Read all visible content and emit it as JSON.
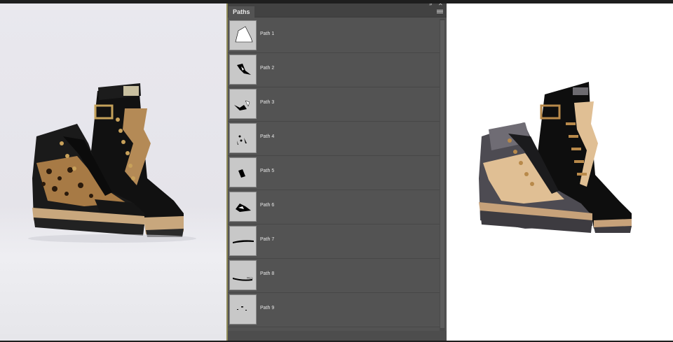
{
  "panel": {
    "tab_label": "Paths",
    "collapse_icon": "double-chevron-icon",
    "close_icon": "close-icon",
    "menu_icon": "panel-menu-icon"
  },
  "paths": [
    {
      "label": "Path 1"
    },
    {
      "label": "Path 2"
    },
    {
      "label": "Path 3"
    },
    {
      "label": "Path 4"
    },
    {
      "label": "Path 5"
    },
    {
      "label": "Path 6"
    },
    {
      "label": "Path 7"
    },
    {
      "label": "Path 8"
    },
    {
      "label": "Path 9"
    }
  ],
  "colors": {
    "photo_bg": "#e9e8ee",
    "panel_bg": "#535353",
    "vector_bg": "#ffffff",
    "boot_black": "#0d0d0d",
    "boot_grey": "#4d4b52",
    "boot_tan": "#e0bf94",
    "boot_gold": "#b8894a",
    "sole_tan": "#c7a27a"
  }
}
